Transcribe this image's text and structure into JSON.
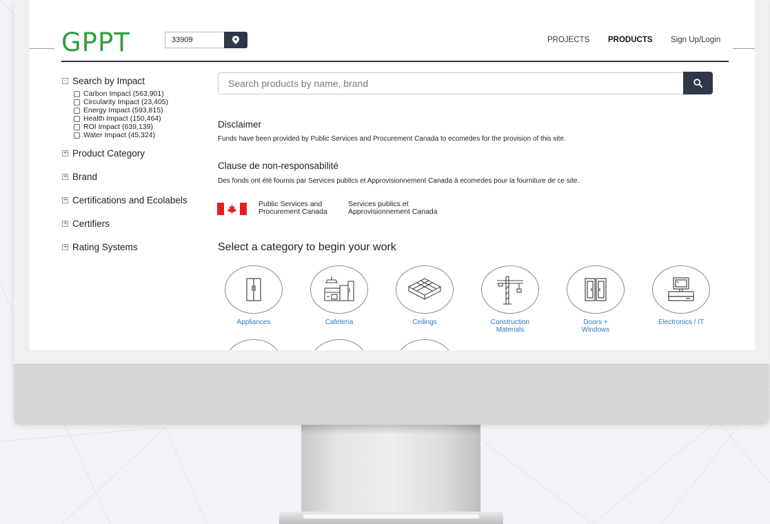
{
  "header": {
    "logo": "GPPT",
    "zip_value": "33909",
    "nav": {
      "projects": "PROJECTS",
      "products": "PRODUCTS",
      "login": "Sign Up/Login"
    }
  },
  "sidebar": {
    "impact_title": "Search by Impact",
    "impact_toggle": "-",
    "impacts": [
      "Carbon Impact (563,901)",
      "Circularity Impact (23,405)",
      "Energy Impact (593,815)",
      "Health Impact (150,464)",
      "ROI Impact (639,139)",
      "Water Impact (45,324)"
    ],
    "collapsed_toggle": "+",
    "facets": [
      "Product Category",
      "Brand",
      "Certifications and Ecolabels",
      "Certifiers",
      "Rating Systems"
    ]
  },
  "search": {
    "placeholder": "Search products by name, brand"
  },
  "disclaimer": {
    "title_en": "Disclaimer",
    "text_en": "Funds have been provided by Public Services and Procurement Canada to ecomedes for the provision of this site.",
    "title_fr": "Clause de non-responsabilité",
    "text_fr": "Des fonds ont été fournis par Services publics et Approvisionnement Canada à ecomedes pour la fourniture de ce site.",
    "agency_en_1": "Public Services and",
    "agency_en_2": "Procurement Canada",
    "agency_fr_1": "Services publics et",
    "agency_fr_2": "Approvisionnement Canada"
  },
  "categories": {
    "title": "Select a category to begin your work",
    "items": [
      {
        "label_1": "Appliances",
        "label_2": "",
        "icon": "appliance-icon"
      },
      {
        "label_1": "Cafeteria",
        "label_2": "",
        "icon": "cafeteria-icon"
      },
      {
        "label_1": "Ceilings",
        "label_2": "",
        "icon": "ceilings-icon"
      },
      {
        "label_1": "Construction",
        "label_2": "Materials",
        "icon": "crane-icon"
      },
      {
        "label_1": "Doors +",
        "label_2": "Windows",
        "icon": "doors-icon"
      },
      {
        "label_1": "Electronics / IT",
        "label_2": "",
        "icon": "computer-icon"
      }
    ]
  },
  "colors": {
    "brand_green": "#2e9e3c",
    "button_navy": "#2e3849",
    "link_blue": "#2e77c0",
    "flag_red": "#e41d24"
  }
}
